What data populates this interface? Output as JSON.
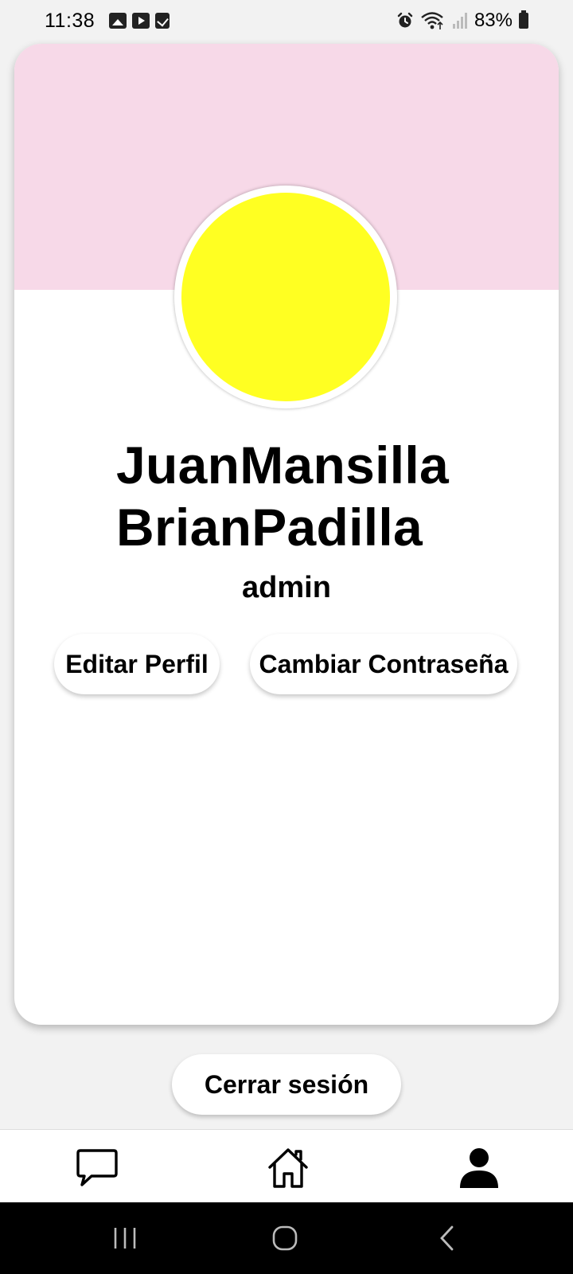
{
  "status_bar": {
    "time": "11:38",
    "battery": "83%",
    "left_icons": [
      "gallery-icon",
      "youtube-icon",
      "task-check-icon"
    ],
    "right_icons": [
      "alarm-icon",
      "wifi-icon",
      "signal-icon",
      "battery-icon"
    ]
  },
  "profile": {
    "name_line1": "JuanMansilla",
    "name_line2": "BrianPadilla",
    "role": "admin",
    "edit_label": "Editar Perfil",
    "change_password_label": "Cambiar Contraseña",
    "header_color": "#f7d9e8",
    "avatar_color": "#ffff22"
  },
  "logout_label": "Cerrar sesión",
  "bottom_nav": {
    "items": [
      {
        "icon": "chat-icon"
      },
      {
        "icon": "home-icon"
      },
      {
        "icon": "profile-icon",
        "active": true
      }
    ]
  },
  "system_nav": [
    "recents-icon",
    "home-circle-icon",
    "back-icon"
  ]
}
